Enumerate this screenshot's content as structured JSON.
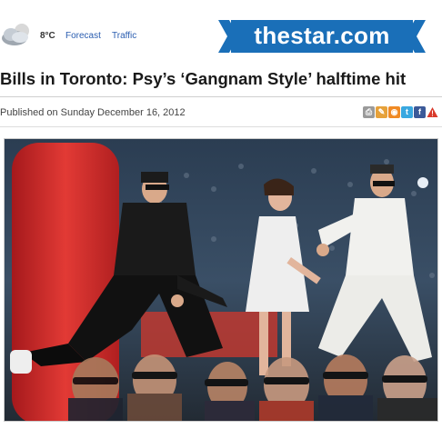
{
  "topbar": {
    "temperature": "8°C",
    "forecast_label": "Forecast",
    "traffic_label": "Traffic",
    "weather_icon": "cloud-sun-icon"
  },
  "logo": {
    "text": "thestar.com",
    "color": "#1a6fb8"
  },
  "article": {
    "headline": "Bills in Toronto: Psy’s ‘Gangnam Style’ halftime hit",
    "published": "Published on Sunday December 16, 2012"
  },
  "tools": [
    "print-icon",
    "comment-icon",
    "rss-icon",
    "twitter-icon",
    "facebook-icon",
    "report-icon"
  ],
  "photo": {
    "subject": "performers dancing on stage before crowd"
  }
}
